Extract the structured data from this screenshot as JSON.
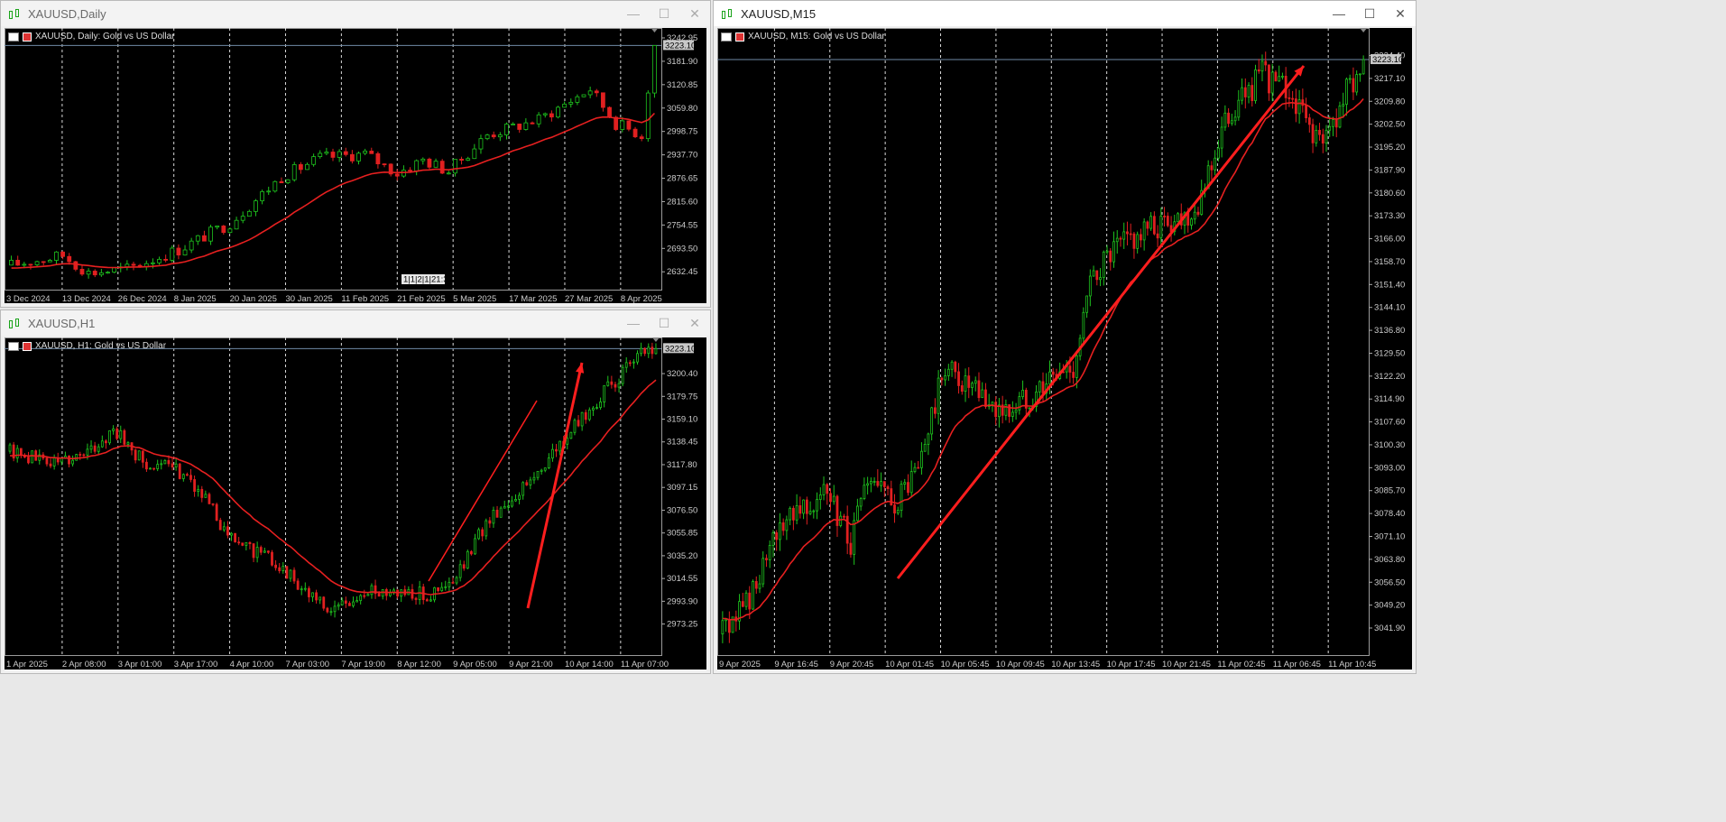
{
  "colors": {
    "bull": "#1ec31e",
    "bear": "#e02020",
    "ma": "#e62020",
    "arrow": "#ff1e1e",
    "grid": "#ffffff",
    "bg": "#000000"
  },
  "windows": {
    "daily": {
      "title": "XAUUSD,Daily",
      "label": "XAUUSD, Daily:  Gold vs US Dollar",
      "price_tag": "3223.10",
      "extra_label": "1|1|2|1|21:30"
    },
    "h1": {
      "title": "XAUUSD,H1",
      "label": "XAUUSD, H1:  Gold vs US Dollar",
      "price_tag": "3223.10"
    },
    "m15": {
      "title": "XAUUSD,M15",
      "label": "XAUUSD, M15:  Gold vs US Dollar",
      "price_tag": "3223.10"
    }
  },
  "chart_data": [
    {
      "id": "daily",
      "type": "candlestick",
      "symbol": "XAUUSD",
      "timeframe": "Daily",
      "ylim": [
        2600,
        3250
      ],
      "y_ticks": [
        3242.95,
        3181.9,
        3120.85,
        3059.8,
        2998.75,
        2937.7,
        2876.65,
        2815.6,
        2754.55,
        2693.5,
        2632.45
      ],
      "x_ticks": [
        "3 Dec 2024",
        "13 Dec 2024",
        "26 Dec 2024",
        "8 Jan 2025",
        "20 Jan 2025",
        "30 Jan 2025",
        "11 Feb 2025",
        "21 Feb 2025",
        "5 Mar 2025",
        "17 Mar 2025",
        "27 Mar 2025",
        "8 Apr 2025"
      ],
      "anchors": [
        [
          0,
          2650
        ],
        [
          8,
          2675
        ],
        [
          12,
          2630
        ],
        [
          18,
          2640
        ],
        [
          26,
          2690
        ],
        [
          34,
          2760
        ],
        [
          42,
          2880
        ],
        [
          48,
          2930
        ],
        [
          55,
          2940
        ],
        [
          60,
          2890
        ],
        [
          64,
          2925
        ],
        [
          68,
          2895
        ],
        [
          74,
          2990
        ],
        [
          82,
          3030
        ],
        [
          90,
          3110
        ],
        [
          94,
          3020
        ],
        [
          98,
          2990
        ],
        [
          100,
          3230
        ]
      ],
      "n": 101,
      "ma_start": 2640,
      "last": 3223.1
    },
    {
      "id": "h1",
      "type": "candlestick",
      "symbol": "XAUUSD",
      "timeframe": "H1",
      "ylim": [
        2950,
        3225
      ],
      "y_ticks": [
        3200.4,
        3179.75,
        3159.1,
        3138.45,
        3117.8,
        3097.15,
        3076.5,
        3055.85,
        3035.2,
        3014.55,
        2993.9,
        2973.25
      ],
      "x_ticks": [
        "1 Apr 2025",
        "2 Apr 08:00",
        "3 Apr 01:00",
        "3 Apr 17:00",
        "4 Apr 10:00",
        "7 Apr 03:00",
        "7 Apr 19:00",
        "8 Apr 12:00",
        "9 Apr 05:00",
        "9 Apr 21:00",
        "10 Apr 14:00",
        "11 Apr 07:00"
      ],
      "anchors": [
        [
          0,
          3130
        ],
        [
          12,
          3120
        ],
        [
          22,
          3130
        ],
        [
          28,
          3150
        ],
        [
          36,
          3120
        ],
        [
          48,
          3110
        ],
        [
          60,
          3050
        ],
        [
          72,
          3030
        ],
        [
          86,
          2985
        ],
        [
          100,
          3005
        ],
        [
          114,
          3000
        ],
        [
          120,
          3010
        ],
        [
          130,
          3070
        ],
        [
          140,
          3100
        ],
        [
          150,
          3140
        ],
        [
          160,
          3180
        ],
        [
          170,
          3215
        ],
        [
          175,
          3223
        ]
      ],
      "n": 176,
      "ma_start": 3125,
      "last": 3223.1
    },
    {
      "id": "m15",
      "type": "candlestick",
      "symbol": "XAUUSD",
      "timeframe": "M15",
      "ylim": [
        3035,
        3228
      ],
      "y_ticks": [
        3224.4,
        3217.1,
        3209.8,
        3202.5,
        3195.2,
        3187.9,
        3180.6,
        3173.3,
        3166.0,
        3158.7,
        3151.4,
        3144.1,
        3136.8,
        3129.5,
        3122.2,
        3114.9,
        3107.6,
        3100.3,
        3093.0,
        3085.7,
        3078.4,
        3071.1,
        3063.8,
        3056.5,
        3049.2,
        3041.9
      ],
      "x_ticks": [
        "9 Apr 2025",
        "9 Apr 16:45",
        "9 Apr 20:45",
        "10 Apr 01:45",
        "10 Apr 05:45",
        "10 Apr 09:45",
        "10 Apr 13:45",
        "10 Apr 17:45",
        "10 Apr 21:45",
        "11 Apr 02:45",
        "11 Apr 06:45",
        "11 Apr 10:45"
      ],
      "anchors": [
        [
          0,
          3040
        ],
        [
          10,
          3055
        ],
        [
          20,
          3080
        ],
        [
          30,
          3085
        ],
        [
          38,
          3070
        ],
        [
          44,
          3090
        ],
        [
          50,
          3080
        ],
        [
          58,
          3092
        ],
        [
          66,
          3125
        ],
        [
          76,
          3115
        ],
        [
          84,
          3110
        ],
        [
          96,
          3120
        ],
        [
          104,
          3125
        ],
        [
          110,
          3155
        ],
        [
          120,
          3165
        ],
        [
          130,
          3170
        ],
        [
          140,
          3175
        ],
        [
          150,
          3205
        ],
        [
          160,
          3218
        ],
        [
          168,
          3212
        ],
        [
          178,
          3195
        ],
        [
          186,
          3215
        ],
        [
          190,
          3222
        ]
      ],
      "n": 191,
      "ma_start": 3045,
      "last": 3223.1
    }
  ]
}
